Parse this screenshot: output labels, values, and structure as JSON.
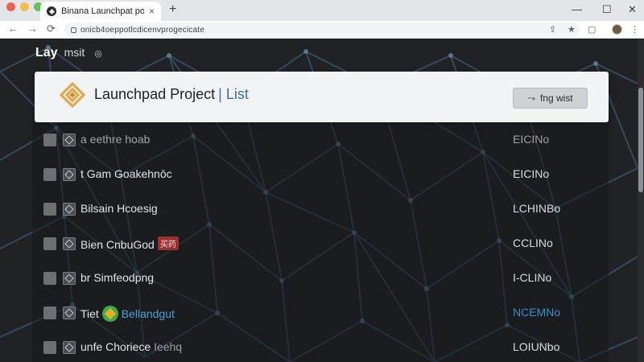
{
  "browser": {
    "tab_title": "Binana Launchpat pon",
    "tab_close": "×",
    "new_tab": "+",
    "url": "onicb4oeppotlcdicenvprogecicate",
    "win_min": "—",
    "win_max": "☐",
    "win_close": "✕",
    "nav_back": "←",
    "nav_forward": "→",
    "nav_reload": "⟳"
  },
  "site": {
    "logo_bold": "Lay",
    "logo_rest": "msit",
    "logo_extra": "◎"
  },
  "header": {
    "title": "Launchpad Project",
    "separator": "|",
    "subtitle": "List",
    "button_label": "fng wist",
    "button_icon": "⤳"
  },
  "rows": [
    {
      "name": "a eethre hoab",
      "status": "EICINo",
      "tag": "",
      "coin": false
    },
    {
      "name": "t Gam Goakehnōc",
      "status": "EICINo",
      "tag": "",
      "coin": false
    },
    {
      "name": "Bilsain Hcoesig",
      "status": "LCHINBo",
      "tag": "",
      "coin": false
    },
    {
      "name": "Bien CnbuGod",
      "status": "CCLINo",
      "tag": "买药",
      "coin": false
    },
    {
      "name": "br Simfeodpng",
      "status": "I-CLINo",
      "tag": "",
      "coin": false
    },
    {
      "name": "Tiet",
      "name2": "Bellandgut",
      "status": "NCEMNo",
      "tag": "",
      "coin": true
    },
    {
      "name": "unfe Choriece",
      "name2": "Ieehq",
      "status": "LOIUNbo",
      "tag": "",
      "coin": false
    }
  ],
  "colors": {
    "accent_blue": "#3a6fa5",
    "brand_gold": "#e2a84a",
    "tag_red": "#9c2f2f",
    "coin_green": "#3eaa4e"
  }
}
